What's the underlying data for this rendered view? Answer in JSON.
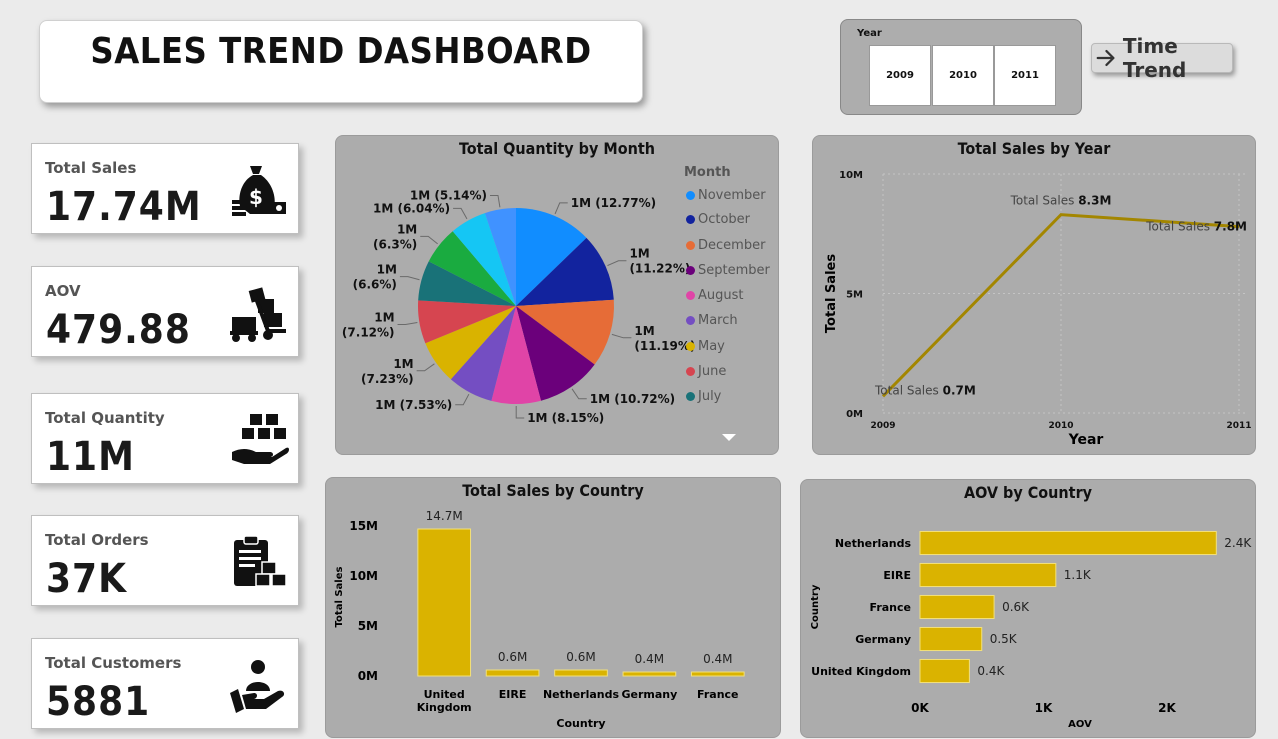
{
  "header": {
    "title": "SALES TREND DASHBOARD"
  },
  "slicer": {
    "label": "Year",
    "options": [
      "2009",
      "2010",
      "2011"
    ]
  },
  "nav": {
    "label": "Time Trend",
    "icon": "arrow-right-icon"
  },
  "kpis": [
    {
      "label": "Total Sales",
      "value": "17.74M",
      "icon": "money-bag-icon"
    },
    {
      "label": "AOV",
      "value": "479.88",
      "icon": "hand-truck-boxes-icon"
    },
    {
      "label": "Total Quantity",
      "value": "11M",
      "icon": "hand-boxes-icon"
    },
    {
      "label": "Total Orders",
      "value": "37K",
      "icon": "clipboard-boxes-icon"
    },
    {
      "label": "Total Customers",
      "value": "5881",
      "icon": "customer-hand-icon"
    }
  ],
  "colors": {
    "accent": "#dab300",
    "line": "#a38600",
    "panel": "#acacac"
  },
  "chart_data": [
    {
      "type": "pie",
      "title": "Total Quantity by Month",
      "legend_title": "Month",
      "legend_position": "right",
      "slices": [
        {
          "name": "November",
          "percent": 12.77,
          "label": "1M (12.77%)",
          "color": "#118dff"
        },
        {
          "name": "October",
          "percent": 11.22,
          "label": "1M (11.22%)",
          "color": "#12239e"
        },
        {
          "name": "December",
          "percent": 11.19,
          "label": "1M (11.19%)",
          "color": "#e66c37"
        },
        {
          "name": "September",
          "percent": 10.72,
          "label": "1M (10.72%)",
          "color": "#6b007b"
        },
        {
          "name": "August",
          "percent": 8.15,
          "label": "1M (8.15%)",
          "color": "#e044a7"
        },
        {
          "name": "March",
          "percent": 7.53,
          "label": "1M (7.53%)",
          "color": "#744ec2"
        },
        {
          "name": "May",
          "percent": 7.23,
          "label": "1M (7.23%)",
          "color": "#d9b300"
        },
        {
          "name": "June",
          "percent": 7.12,
          "label": "1M (7.12%)",
          "color": "#d64550"
        },
        {
          "name": "July",
          "percent": 6.6,
          "label": "1M (6.6%)",
          "color": "#197278"
        },
        {
          "percent": 6.3,
          "label": "1M (6.3%)",
          "color": "#1aab40"
        },
        {
          "percent": 6.04,
          "label": "1M (6.04%)",
          "color": "#15c6f4"
        },
        {
          "percent": 5.14,
          "label": "1M (5.14%)",
          "color": "#4092ff"
        }
      ]
    },
    {
      "type": "line",
      "title": "Total Sales by Year",
      "xlabel": "Year",
      "ylabel": "Total Sales",
      "x": [
        "2009",
        "2010",
        "2011"
      ],
      "values": [
        0.7,
        8.3,
        7.8
      ],
      "unit": "M",
      "data_label_prefix": "Total Sales",
      "data_labels": [
        "0.7M",
        "8.3M",
        "7.8M"
      ],
      "yticks": [
        "0M",
        "5M",
        "10M"
      ],
      "ylim": [
        0,
        10
      ],
      "grid": true
    },
    {
      "type": "bar",
      "title": "Total Sales by Country",
      "xlabel": "Country",
      "ylabel": "Total Sales",
      "categories": [
        "United Kingdom",
        "EIRE",
        "Netherlands",
        "Germany",
        "France"
      ],
      "values": [
        14.7,
        0.6,
        0.6,
        0.4,
        0.4
      ],
      "data_labels": [
        "14.7M",
        "0.6M",
        "0.6M",
        "0.4M",
        "0.4M"
      ],
      "yticks": [
        "0M",
        "5M",
        "10M",
        "15M"
      ],
      "ylim": [
        0,
        15
      ]
    },
    {
      "type": "bar",
      "orientation": "horizontal",
      "title": "AOV by Country",
      "xlabel": "AOV",
      "ylabel": "Country",
      "categories": [
        "Netherlands",
        "EIRE",
        "France",
        "Germany",
        "United Kingdom"
      ],
      "values": [
        2.4,
        1.1,
        0.6,
        0.5,
        0.4
      ],
      "data_labels": [
        "2.4K",
        "1.1K",
        "0.6K",
        "0.5K",
        "0.4K"
      ],
      "xticks": [
        "0K",
        "1K",
        "2K"
      ],
      "xlim": [
        0,
        2.6
      ]
    }
  ]
}
